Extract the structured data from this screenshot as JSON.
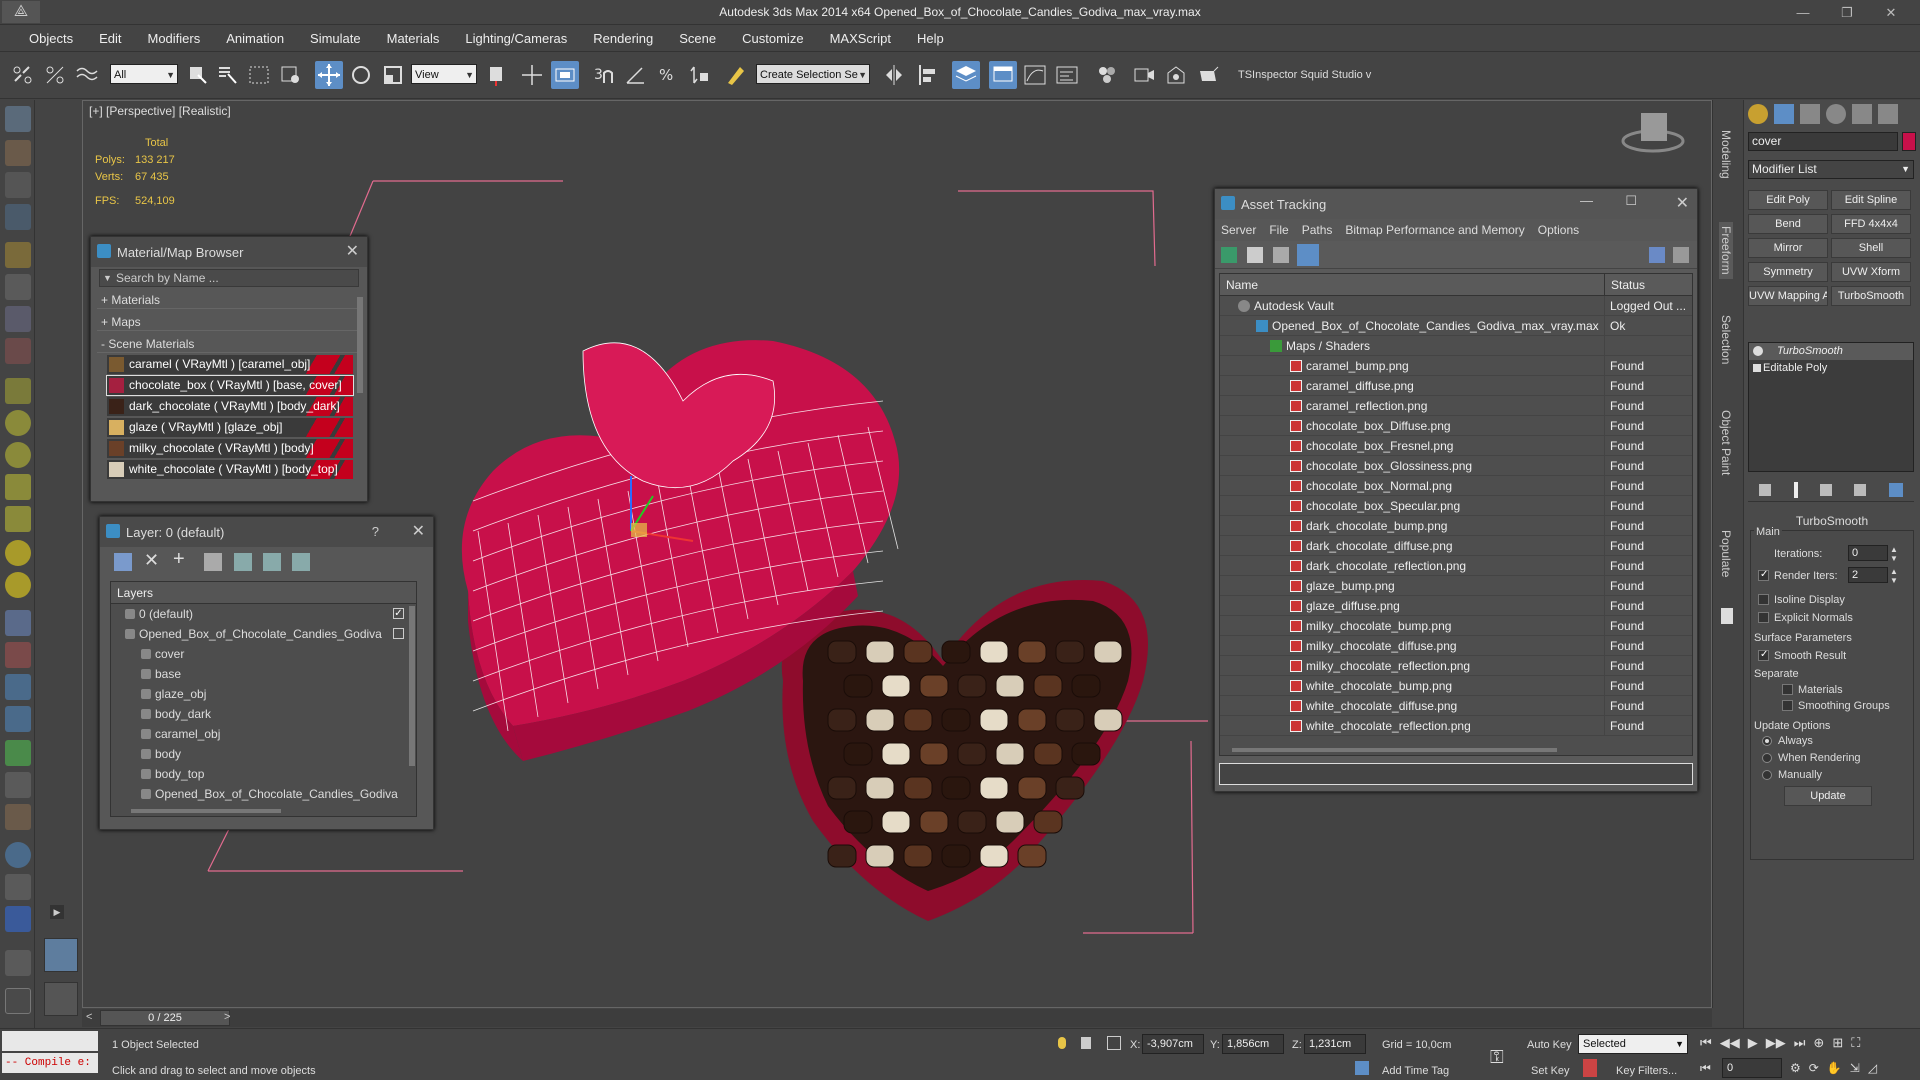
{
  "window": {
    "title": "Autodesk 3ds Max  2014 x64     Opened_Box_of_Chocolate_Candies_Godiva_max_vray.max",
    "controls": [
      "—",
      "❐",
      "✕"
    ]
  },
  "menu": [
    "Objects",
    "Edit",
    "Modifiers",
    "Animation",
    "Simulate",
    "Materials",
    "Lighting/Cameras",
    "Rendering",
    "Scene",
    "Customize",
    "MAXScript",
    "Help"
  ],
  "toolbar": {
    "filter_value": "All",
    "ref_coord_value": "View",
    "selection_set_placeholder": "Create Selection Se",
    "plugins_label": "TSInspector  Squid Studio v"
  },
  "viewport": {
    "label": "[+] [Perspective] [Realistic]",
    "stats": {
      "total_label": "Total",
      "polys_label": "Polys:",
      "polys": "133 217",
      "verts_label": "Verts:",
      "verts": "67 435",
      "fps_label": "FPS:",
      "fps": "524,109"
    }
  },
  "material_browser": {
    "title": "Material/Map Browser",
    "search_placeholder": "Search by Name ...",
    "sections": {
      "materials": "+ Materials",
      "maps": "+ Maps",
      "scene": "- Scene Materials"
    },
    "items": [
      "caramel  ( VRayMtl ) [caramel_obj]",
      "chocolate_box  ( VRayMtl ) [base, cover]",
      "dark_chocolate  ( VRayMtl ) [body_dark]",
      "glaze  ( VRayMtl ) [glaze_obj]",
      "milky_chocolate  ( VRayMtl ) [body]",
      "white_chocolate  ( VRayMtl ) [body_top]"
    ]
  },
  "layer_panel": {
    "title": "Layer: 0 (default)",
    "help": "?",
    "header": "Layers",
    "rows": [
      {
        "label": "0 (default)",
        "indent": 1
      },
      {
        "label": "Opened_Box_of_Chocolate_Candies_Godiva",
        "indent": 1
      },
      {
        "label": "cover",
        "indent": 2
      },
      {
        "label": "base",
        "indent": 2
      },
      {
        "label": "glaze_obj",
        "indent": 2
      },
      {
        "label": "body_dark",
        "indent": 2
      },
      {
        "label": "caramel_obj",
        "indent": 2
      },
      {
        "label": "body",
        "indent": 2
      },
      {
        "label": "body_top",
        "indent": 2
      },
      {
        "label": "Opened_Box_of_Chocolate_Candies_Godiva",
        "indent": 2
      }
    ]
  },
  "asset_tracking": {
    "title": "Asset Tracking",
    "menu": [
      "Server",
      "File",
      "Paths",
      "Bitmap Performance and Memory",
      "Options"
    ],
    "columns": [
      "Name",
      "Status"
    ],
    "rows": [
      {
        "name": "Autodesk Vault",
        "status": "Logged Out ...",
        "level": 0
      },
      {
        "name": "Opened_Box_of_Chocolate_Candies_Godiva_max_vray.max",
        "status": "Ok",
        "level": 1
      },
      {
        "name": "Maps / Shaders",
        "status": "",
        "level": 2
      },
      {
        "name": "caramel_bump.png",
        "status": "Found",
        "level": 3
      },
      {
        "name": "caramel_diffuse.png",
        "status": "Found",
        "level": 3
      },
      {
        "name": "caramel_reflection.png",
        "status": "Found",
        "level": 3
      },
      {
        "name": "chocolate_box_Diffuse.png",
        "status": "Found",
        "level": 3
      },
      {
        "name": "chocolate_box_Fresnel.png",
        "status": "Found",
        "level": 3
      },
      {
        "name": "chocolate_box_Glossiness.png",
        "status": "Found",
        "level": 3
      },
      {
        "name": "chocolate_box_Normal.png",
        "status": "Found",
        "level": 3
      },
      {
        "name": "chocolate_box_Specular.png",
        "status": "Found",
        "level": 3
      },
      {
        "name": "dark_chocolate_bump.png",
        "status": "Found",
        "level": 3
      },
      {
        "name": "dark_chocolate_diffuse.png",
        "status": "Found",
        "level": 3
      },
      {
        "name": "dark_chocolate_reflection.png",
        "status": "Found",
        "level": 3
      },
      {
        "name": "glaze_bump.png",
        "status": "Found",
        "level": 3
      },
      {
        "name": "glaze_diffuse.png",
        "status": "Found",
        "level": 3
      },
      {
        "name": "milky_chocolate_bump.png",
        "status": "Found",
        "level": 3
      },
      {
        "name": "milky_chocolate_diffuse.png",
        "status": "Found",
        "level": 3
      },
      {
        "name": "milky_chocolate_reflection.png",
        "status": "Found",
        "level": 3
      },
      {
        "name": "white_chocolate_bump.png",
        "status": "Found",
        "level": 3
      },
      {
        "name": "white_chocolate_diffuse.png",
        "status": "Found",
        "level": 3
      },
      {
        "name": "white_chocolate_reflection.png",
        "status": "Found",
        "level": 3
      }
    ]
  },
  "ribbon_tabs": [
    "Modeling",
    "Freeform",
    "Selection",
    "Object Paint",
    "Populate"
  ],
  "command_panel": {
    "object_name": "cover",
    "modifier_list": "Modifier List",
    "buttons": [
      "Edit Poly",
      "Edit Spline",
      "Bend",
      "FFD 4x4x4",
      "Mirror",
      "Shell",
      "Symmetry",
      "UVW Xform",
      "UVW Mapping Ac",
      "TurboSmooth"
    ],
    "stack": [
      "TurboSmooth",
      "Editable Poly"
    ],
    "rollout_title": "TurboSmooth",
    "main_label": "Main",
    "iterations_label": "Iterations:",
    "iterations": "0",
    "render_iters_label": "Render Iters:",
    "render_iters": "2",
    "isoline": "Isoline Display",
    "explicit_normals": "Explicit Normals",
    "surface_params": "Surface Parameters",
    "smooth_result": "Smooth Result",
    "separate": "Separate",
    "materials": "Materials",
    "smoothing_groups": "Smoothing Groups",
    "update_options": "Update Options",
    "always": "Always",
    "when_rendering": "When Rendering",
    "manually": "Manually",
    "update_button": "Update"
  },
  "timeline": {
    "frame": "0 / 225",
    "prev": "<",
    "next": ">"
  },
  "status": {
    "maxscript": "-- Compile e:",
    "selection": "1 Object Selected",
    "prompt": "Click and drag to select and move objects",
    "x_label": "X:",
    "x": "-3,907cm",
    "y_label": "Y:",
    "y": "1,856cm",
    "z_label": "Z:",
    "z": "1,231cm",
    "grid": "Grid = 10,0cm",
    "add_time_tag": "Add Time Tag",
    "auto_key": "Auto Key",
    "selected": "Selected",
    "set_key": "Set Key",
    "key_filters": "Key Filters...",
    "frame_field": "0"
  },
  "colors": {
    "accent": "#5d8ec6",
    "material_red": "#c4001d",
    "stat_yellow": "#e8c547",
    "box_pink": "#c8104a"
  }
}
